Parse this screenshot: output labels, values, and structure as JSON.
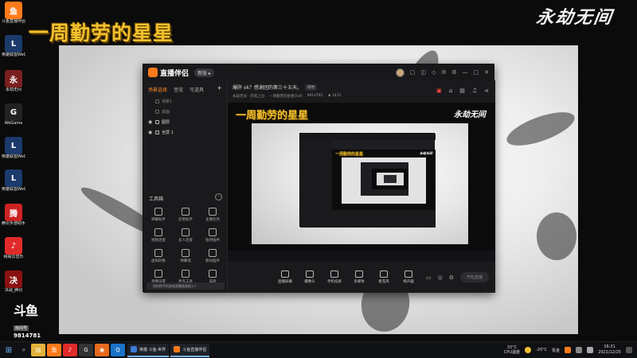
{
  "overlay": {
    "title": "一周勤劳的星星",
    "game_logo": "永劫无间"
  },
  "desktop_icons": [
    {
      "label": "斗鱼直播伴侣",
      "icon": "douyu-app-icon",
      "color": "#ff7a1a",
      "glyph": "鱼"
    },
    {
      "label": "英雄联盟WeGame版",
      "icon": "lol-icon",
      "color": "#1b3a6b",
      "glyph": "L"
    },
    {
      "label": "永劫无间",
      "icon": "naraka-icon",
      "color": "#7a1f1f",
      "glyph": "永"
    },
    {
      "label": "WeGame",
      "icon": "wegame-icon",
      "color": "#222",
      "glyph": "G"
    },
    {
      "label": "英雄联盟WeGame版",
      "icon": "lol-icon",
      "color": "#1b3a6b",
      "glyph": "L"
    },
    {
      "label": "英雄联盟WeGame版",
      "icon": "lol-icon",
      "color": "#1b3a6b",
      "glyph": "L"
    },
    {
      "label": "腾讯手游助手",
      "icon": "tencent-emulator-icon",
      "color": "#c22",
      "glyph": "腾"
    },
    {
      "label": "网易云音乐",
      "icon": "netease-music-icon",
      "color": "#e12a2a",
      "glyph": "♪"
    },
    {
      "label": "决战_腾讯",
      "icon": "game-icon",
      "color": "#8a1111",
      "glyph": "决"
    }
  ],
  "app": {
    "brand": "直播伴侣",
    "version_badge": "新版 ▸",
    "titlebar_icons": [
      "user-avatar",
      "menu-icon",
      "box-icon",
      "shirt-icon",
      "mail-icon",
      "settings-icon",
      "minimize-icon",
      "maximize-icon",
      "close-icon"
    ],
    "sidebar": {
      "tabs": [
        "场景选择",
        "音效",
        "可道具"
      ],
      "add": "+",
      "scenes": [
        {
          "label": "场景1",
          "visible": false
        },
        {
          "label": "桌面",
          "visible": false
        },
        {
          "label": "图层",
          "visible": true
        },
        {
          "label": "全屏 1",
          "visible": true
        }
      ],
      "tools_title": "工具箱",
      "tools_more": "···",
      "tools": [
        {
          "label": "弹幕助手",
          "icon": "danmu-icon"
        },
        {
          "label": "房管助手",
          "icon": "admin-icon"
        },
        {
          "label": "主播任务",
          "icon": "task-icon"
        },
        {
          "label": "视频连麦",
          "icon": "video-link-icon"
        },
        {
          "label": "多人连麦",
          "icon": "multi-link-icon"
        },
        {
          "label": "鱼吧插件",
          "icon": "plugin-icon"
        },
        {
          "label": "虚拟形象",
          "icon": "avatar-icon"
        },
        {
          "label": "弹幕墙",
          "icon": "danmu-wall-icon"
        },
        {
          "label": "歌词插件",
          "icon": "lyrics-icon"
        },
        {
          "label": "直播设置",
          "icon": "live-settings-icon"
        },
        {
          "label": "更多工具",
          "icon": "more-tools-icon"
        },
        {
          "label": "美颜",
          "icon": "beauty-icon"
        }
      ],
      "tip": "如何把手机游戏直播画面接入？"
    },
    "stream": {
      "title": "爆肝 ok？感谢团的第三十五天。",
      "edit": "修改",
      "category": "永劫无间 · 开黑上分",
      "streamer": "一周勤劳的星星OvO",
      "room_id": "9814781",
      "followers": "1415"
    },
    "bottom_bar": [
      {
        "label": "直播屏幕",
        "icon": "screen-icon"
      },
      {
        "label": "摄像头",
        "icon": "camera-icon"
      },
      {
        "label": "手机投屏",
        "icon": "phone-cast-icon"
      },
      {
        "label": "多媒体",
        "icon": "media-icon"
      },
      {
        "label": "麦克风",
        "icon": "mic-icon"
      },
      {
        "label": "扬声器",
        "icon": "speaker-icon"
      }
    ],
    "go_live": "开始直播"
  },
  "douyu": {
    "logo": "斗鱼",
    "room_label": "房间号",
    "room_id": "9814781"
  },
  "taskbar": {
    "apps": [
      {
        "icon": "file-explorer-icon",
        "color": "#e3b23c",
        "glyph": "▤"
      },
      {
        "icon": "douyu-app-icon",
        "color": "#ff7a1a",
        "glyph": "鱼"
      },
      {
        "icon": "netease-music-icon",
        "color": "#e12a2a",
        "glyph": "♪"
      },
      {
        "icon": "wegame-icon",
        "color": "#333",
        "glyph": "G"
      },
      {
        "icon": "firefox-icon",
        "color": "#e66b1f",
        "glyph": "◉"
      },
      {
        "icon": "tencent-icon",
        "color": "#1a73c8",
        "glyph": "Q"
      }
    ],
    "tasks": [
      {
        "label": "英雄·斗鱼·世界",
        "color": "#3b7bd8"
      },
      {
        "label": "斗鱼直播伴侣",
        "color": "#ff7a1a"
      }
    ],
    "weather_temp": "33°C",
    "weather_text": "CPU温度",
    "outdoor_temp": "-20°C",
    "outdoor_text": "氪金",
    "time": "16:31",
    "date": "2021/12/25"
  }
}
